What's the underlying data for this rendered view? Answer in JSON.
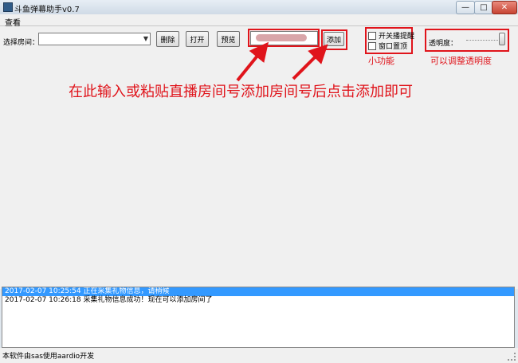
{
  "window": {
    "title": "斗鱼弹幕助手v0.7",
    "minimize_glyph": "—",
    "maximize_glyph": "□",
    "close_glyph": "✕"
  },
  "menu": {
    "view": "查看"
  },
  "toolbar": {
    "room_label": "选择房间：",
    "select_value": "",
    "delete_label": "删除",
    "open_label": "打开",
    "preview_label": "预览",
    "add_label": "添加",
    "room_input_value": ""
  },
  "features": {
    "checkbox_1": "开关播提醒",
    "checkbox_2": "窗口置顶",
    "opacity_label": "透明度："
  },
  "annotations": {
    "main": "在此输入或粘贴直播房间号添加房间号后点击添加即可",
    "small_features": "小功能",
    "opacity_hint": "可以调整透明度"
  },
  "log": [
    {
      "text": "2017-02-07 10:25:54 正在采集礼物信息，请稍候",
      "selected": true
    },
    {
      "text": "2017-02-07 10:26:18 采集礼物信息成功！现在可以添加房间了",
      "selected": false
    }
  ],
  "status": {
    "text": "本软件由sas使用aardio开发"
  },
  "opacity_slider": {
    "value_fraction": 1.0
  },
  "colors": {
    "annotation_red": "#e0141b",
    "selection_blue": "#3399ff"
  }
}
